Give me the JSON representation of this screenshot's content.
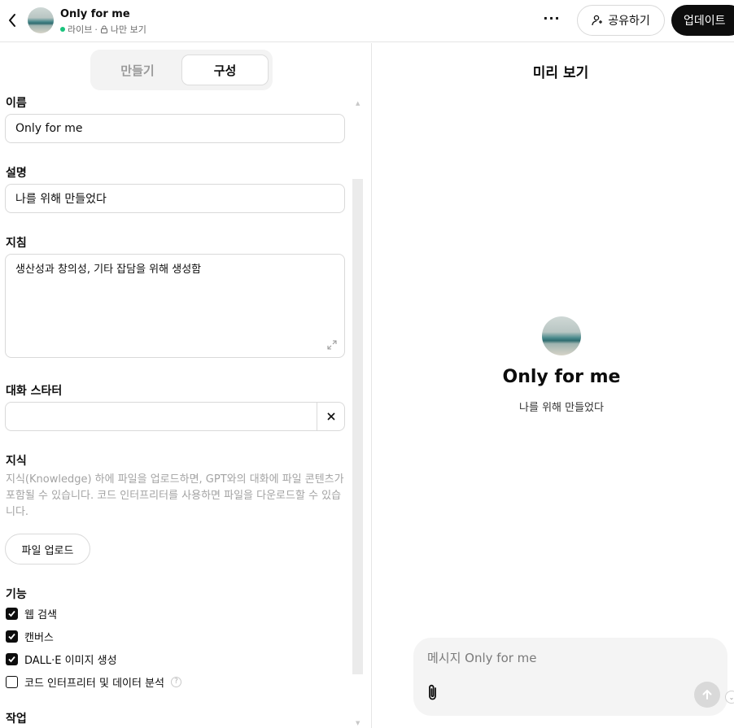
{
  "header": {
    "gpt_name": "Only for me",
    "status": "라이브",
    "separator": "·",
    "visibility": "나만 보기",
    "share_label": "공유하기",
    "update_label": "업데이트",
    "more_label": "···"
  },
  "editor": {
    "tabs": [
      {
        "label": "만들기",
        "active": false
      },
      {
        "label": "구성",
        "active": true
      }
    ],
    "name_label": "이름",
    "name_value": "Only for me",
    "description_label": "설명",
    "description_value": "나를 위해 만들었다",
    "instructions_label": "지침",
    "instructions_value": "생산성과 창의성, 기타 잡담을 위해 생성함",
    "starters_label": "대화 스타터",
    "starter_value": "",
    "knowledge_label": "지식",
    "knowledge_help": "지식(Knowledge) 하에 파일을 업로드하면, GPT와의 대화에 파일 콘텐츠가 포함될 수 있습니다. 코드 인터프리터를 사용하면 파일을 다운로드할 수 있습니다.",
    "upload_label": "파일 업로드",
    "capabilities_label": "기능",
    "capabilities": [
      {
        "label": "웹 검색",
        "checked": true
      },
      {
        "label": "캔버스",
        "checked": true
      },
      {
        "label": "DALL·E 이미지 생성",
        "checked": true
      },
      {
        "label": "코드 인터프리터 및 데이터 분석",
        "checked": false
      }
    ],
    "actions_label": "작업"
  },
  "preview": {
    "title": "미리 보기",
    "gpt_name": "Only for me",
    "gpt_description": "나를 위해 만들었다",
    "composer_placeholder": "메시지 Only for me"
  },
  "colors": {
    "accent": "#0d0d0d",
    "live": "#19c37d"
  }
}
